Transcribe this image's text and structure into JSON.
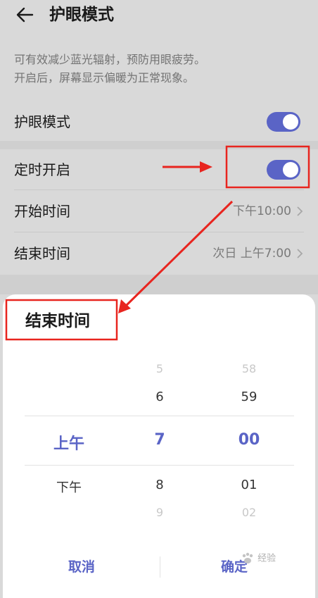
{
  "header": {
    "title": "护眼模式"
  },
  "description": {
    "line1": "可有效减少蓝光辐射，预防用眼疲劳。",
    "line2": "开启后，屏幕显示偏暖为正常现象。"
  },
  "settings": {
    "eye_care": {
      "label": "护眼模式",
      "enabled": true
    },
    "scheduled": {
      "label": "定时开启",
      "enabled": true
    },
    "start_time": {
      "label": "开始时间",
      "value": "下午10:00"
    },
    "end_time": {
      "label": "结束时间",
      "value": "次日 上午7:00"
    }
  },
  "dialog": {
    "title": "结束时间",
    "ampm": {
      "above": "",
      "selected": "上午",
      "below": "下午"
    },
    "hours": {
      "far_above": "5",
      "above": "6",
      "selected": "7",
      "below": "8",
      "far_below": "9"
    },
    "minutes": {
      "far_above": "58",
      "above": "59",
      "selected": "00",
      "below": "01",
      "far_below": "02"
    },
    "cancel_label": "取消",
    "confirm_label": "确定"
  },
  "watermark": "经验",
  "colors": {
    "accent": "#5a64c6",
    "annotation": "#e8251f",
    "background": "#d9d9d9"
  }
}
